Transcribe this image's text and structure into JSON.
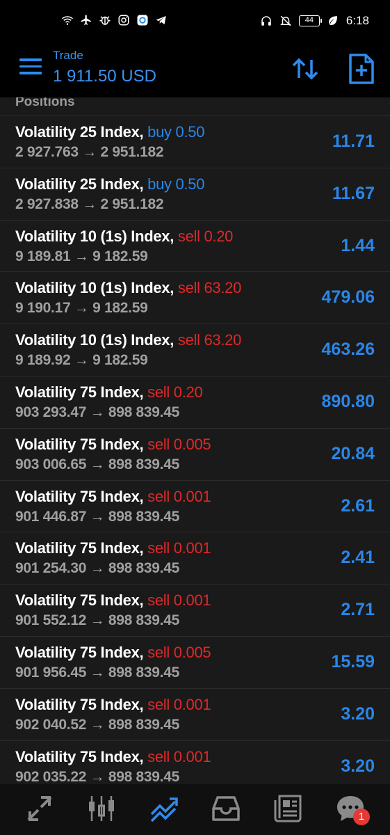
{
  "status_bar": {
    "battery": "44",
    "time": "6:18",
    "left_icons": [
      "wifi-icon",
      "airplane-icon",
      "bug-icon",
      "instagram-icon",
      "app-icon",
      "telegram-icon"
    ],
    "right_icons": [
      "headphones-icon",
      "bell-muted-icon",
      "battery-icon",
      "leaf-icon"
    ]
  },
  "toolbar": {
    "title": "Trade",
    "balance": "1 911.50 USD",
    "accent_color": "#2e8cf0"
  },
  "positions": {
    "header": "Positions",
    "items": [
      {
        "symbol": "Volatility 25 Index,",
        "side": "buy 0.50",
        "type": "buy",
        "prices": "2 927.763 → 2 951.182",
        "profit": "11.71"
      },
      {
        "symbol": "Volatility 25 Index,",
        "side": "buy 0.50",
        "type": "buy",
        "prices": "2 927.838 → 2 951.182",
        "profit": "11.67"
      },
      {
        "symbol": "Volatility 10 (1s) Index,",
        "side": "sell 0.20",
        "type": "sell",
        "prices": "9 189.81 → 9 182.59",
        "profit": "1.44"
      },
      {
        "symbol": "Volatility 10 (1s) Index,",
        "side": "sell 63.20",
        "type": "sell",
        "prices": "9 190.17 → 9 182.59",
        "profit": "479.06"
      },
      {
        "symbol": "Volatility 10 (1s) Index,",
        "side": "sell 63.20",
        "type": "sell",
        "prices": "9 189.92 → 9 182.59",
        "profit": "463.26"
      },
      {
        "symbol": "Volatility 75 Index,",
        "side": "sell 0.20",
        "type": "sell",
        "prices": "903 293.47 → 898 839.45",
        "profit": "890.80"
      },
      {
        "symbol": "Volatility 75 Index,",
        "side": "sell 0.005",
        "type": "sell",
        "prices": "903 006.65 → 898 839.45",
        "profit": "20.84"
      },
      {
        "symbol": "Volatility 75 Index,",
        "side": "sell 0.001",
        "type": "sell",
        "prices": "901 446.87 → 898 839.45",
        "profit": "2.61"
      },
      {
        "symbol": "Volatility 75 Index,",
        "side": "sell 0.001",
        "type": "sell",
        "prices": "901 254.30 → 898 839.45",
        "profit": "2.41"
      },
      {
        "symbol": "Volatility 75 Index,",
        "side": "sell 0.001",
        "type": "sell",
        "prices": "901 552.12 → 898 839.45",
        "profit": "2.71"
      },
      {
        "symbol": "Volatility 75 Index,",
        "side": "sell 0.005",
        "type": "sell",
        "prices": "901 956.45 → 898 839.45",
        "profit": "15.59"
      },
      {
        "symbol": "Volatility 75 Index,",
        "side": "sell 0.001",
        "type": "sell",
        "prices": "902 040.52 → 898 839.45",
        "profit": "3.20"
      },
      {
        "symbol": "Volatility 75 Index,",
        "side": "sell 0.001",
        "type": "sell",
        "prices": "902 035.22 → 898 839.45",
        "profit": "3.20"
      }
    ]
  },
  "bottom_nav": {
    "items": [
      "quotes-icon",
      "chart-icon",
      "trade-icon",
      "history-icon",
      "news-icon",
      "messages-icon"
    ],
    "active": "trade-icon",
    "messages_badge": "1"
  },
  "colors": {
    "buy": "#2b86e8",
    "sell": "#e0282a",
    "profit": "#2b86e8",
    "background": "#1a1a1a"
  }
}
